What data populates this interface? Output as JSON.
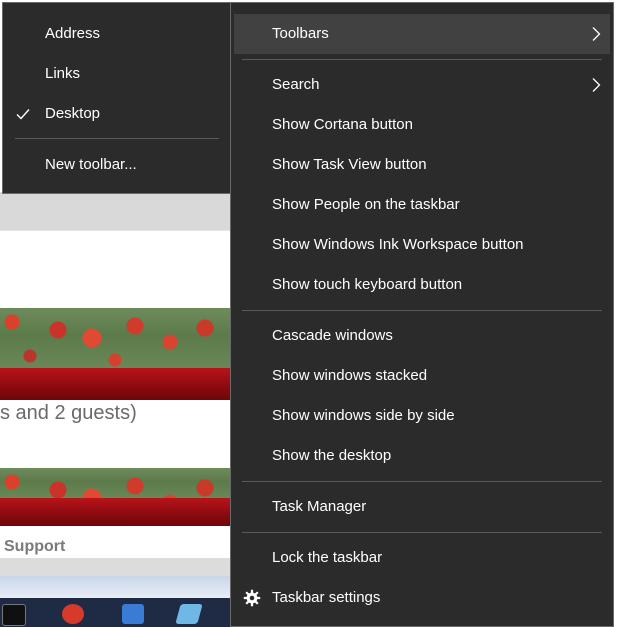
{
  "background_page": {
    "partial_text_guests": "s and 2 guests)",
    "partial_text_support": "Support"
  },
  "toolbars_submenu": {
    "items": [
      {
        "label": "Address",
        "checked": false
      },
      {
        "label": "Links",
        "checked": false
      },
      {
        "label": "Desktop",
        "checked": true
      }
    ],
    "new_toolbar_label": "New toolbar..."
  },
  "taskbar_menu": {
    "toolbars_label": "Toolbars",
    "search_label": "Search",
    "group_1": [
      "Show Cortana button",
      "Show Task View button",
      "Show People on the taskbar",
      "Show Windows Ink Workspace button",
      "Show touch keyboard button"
    ],
    "group_2": [
      "Cascade windows",
      "Show windows stacked",
      "Show windows side by side",
      "Show the desktop"
    ],
    "task_manager_label": "Task Manager",
    "lock_label": "Lock the taskbar",
    "settings_label": "Taskbar settings"
  },
  "icons": {
    "submenu_arrow": "chevron-right-icon",
    "checkmark": "checkmark-icon",
    "settings": "gear-icon"
  },
  "colors": {
    "menu_background": "#2b2b2b",
    "menu_highlight": "#414141",
    "menu_text": "#ffffff",
    "separator": "#5a5a5a"
  }
}
